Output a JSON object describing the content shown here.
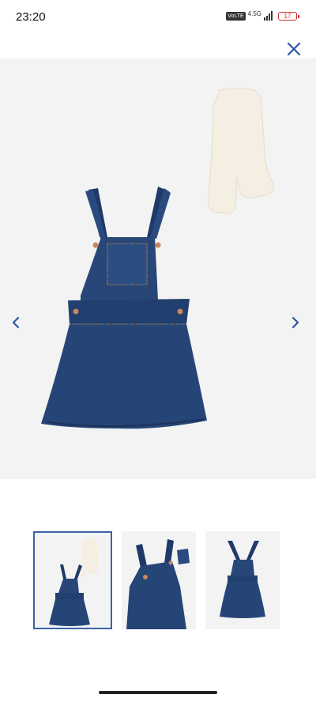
{
  "status_bar": {
    "time": "23:20",
    "network_badge": "VoLTE",
    "network_type": "4.5G",
    "signal_bars": 4,
    "battery_level": "17"
  },
  "icons": {
    "close": "close-icon",
    "prev": "chevron-left-icon",
    "next": "chevron-right-icon"
  },
  "colors": {
    "accent": "#2f55a4",
    "image_bg": "#f3f3f3",
    "denim": "#25406f",
    "battery": "#d32f2f"
  },
  "gallery": {
    "active_index": 0,
    "thumbnail_count": 3
  }
}
